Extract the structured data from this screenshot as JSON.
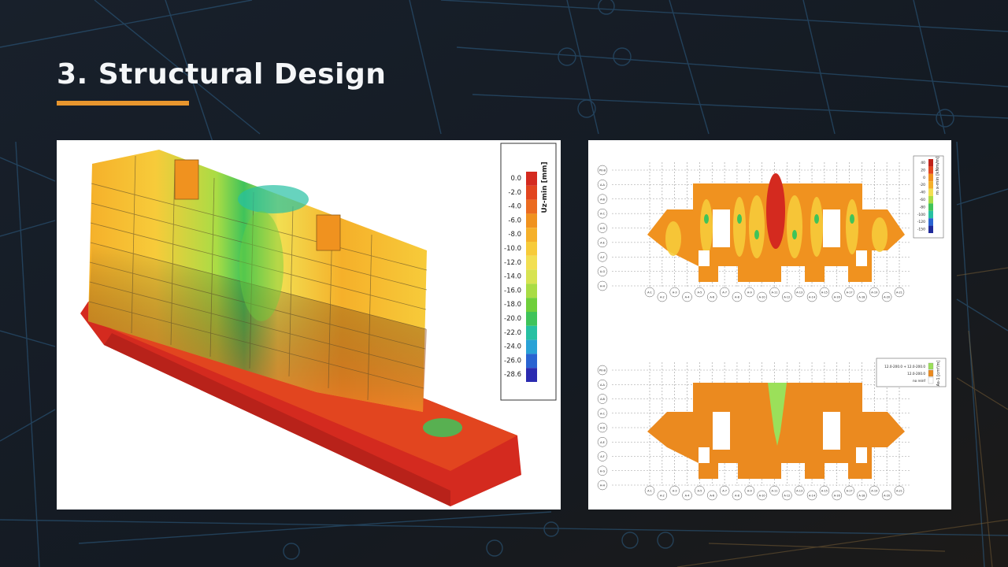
{
  "slide": {
    "title": "3. Structural Design"
  },
  "colors": {
    "background": "#141a22",
    "accent": "#e8962e",
    "title_text": "#f4f6f8"
  },
  "model_3d": {
    "legend_title": "Uz-min [mm]",
    "legend_values": [
      "0.0",
      "-2.0",
      "-4.0",
      "-6.0",
      "-8.0",
      "-10.0",
      "-12.0",
      "-14.0",
      "-16.0",
      "-18.0",
      "-20.0",
      "-22.0",
      "-24.0",
      "-26.0",
      "-28.6"
    ],
    "legend_colors": [
      "#d42a1f",
      "#e2451f",
      "#eb6b20",
      "#f0921f",
      "#f5b02a",
      "#f7cb3a",
      "#f2df52",
      "#d7e352",
      "#a9dc45",
      "#6fcf3b",
      "#3fc35a",
      "#27c0a2",
      "#2aa2d6",
      "#2a64d1",
      "#2b2bb0"
    ]
  },
  "plan_top": {
    "legend_title": "m x-min [kNm/m]",
    "legend_values": [
      "40",
      "20",
      "0",
      "-20",
      "-40",
      "-60",
      "-80",
      "-100",
      "-120",
      "-150"
    ],
    "grid_rows": [
      "P0-B",
      "A-A",
      "A-B",
      "A-C",
      "A-D",
      "A-E",
      "A-F",
      "A-G",
      "A-H"
    ],
    "grid_cols": [
      "A-1",
      "A-2",
      "A-3",
      "A-4",
      "A-5",
      "A-6",
      "A-7",
      "A-8",
      "A-9",
      "A-10",
      "A-11",
      "A-12",
      "A-13",
      "A-14",
      "A-15",
      "A-16",
      "A-17",
      "A-18",
      "A-19",
      "A-20",
      "A-21"
    ]
  },
  "plan_bottom": {
    "legend_title": "As-1 [cm²/m]",
    "legend_items": [
      "12.0-200.0 + 12.0-200.0",
      "12.0-200.0",
      "no reinf"
    ],
    "grid_rows": [
      "P0-B",
      "A-A",
      "A-B",
      "A-C",
      "A-D",
      "A-E",
      "A-F",
      "A-G",
      "A-H"
    ],
    "grid_cols": [
      "A-1",
      "A-2",
      "A-3",
      "A-4",
      "A-5",
      "A-6",
      "A-7",
      "A-8",
      "A-9",
      "A-10",
      "A-11",
      "A-12",
      "A-13",
      "A-14",
      "A-15",
      "A-16",
      "A-17",
      "A-18",
      "A-19",
      "A-20",
      "A-21"
    ]
  }
}
